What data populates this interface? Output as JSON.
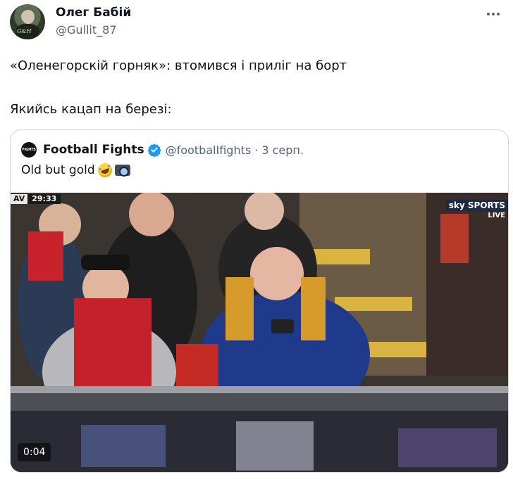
{
  "author": {
    "name": "Олег Бабій",
    "handle": "@Gullit_87",
    "avatar_label": "G&H"
  },
  "tweet": {
    "line1": "«Оленегорскій горняк»: втомився і приліг на борт",
    "line2": "Якийсь кацап на березі:"
  },
  "quoted": {
    "avatar_label": "FIGHTS",
    "name": "Football Fights",
    "handle": "@footbalIfights",
    "date": "· 3 серп.",
    "text": "Old but gold",
    "emojis": [
      "rolling-on-floor-laughing-emoji",
      "camera-with-flash-emoji"
    ],
    "verified": true,
    "verified_color": "#1d9bf0"
  },
  "video": {
    "score_team": "AV",
    "score_time": "29:33",
    "broadcaster": "sky SPORTS",
    "broadcaster_live": "LIVE",
    "duration": "0:04"
  },
  "colors": {
    "text_primary": "#0f1419",
    "text_secondary": "#536471",
    "border": "#cfd9de"
  },
  "icons": {
    "more": "more-dots-icon",
    "verified": "verified-badge-icon"
  }
}
